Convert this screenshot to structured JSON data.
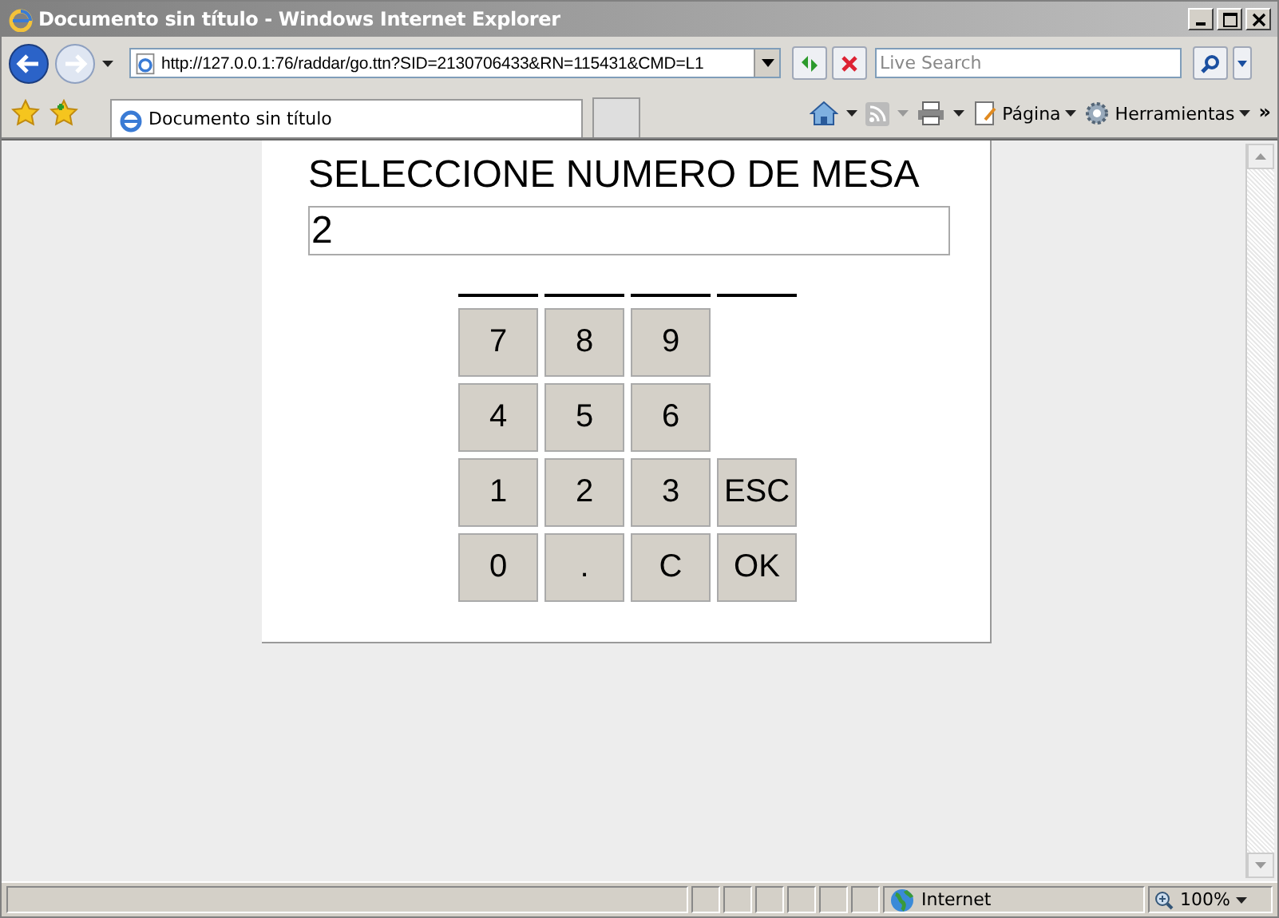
{
  "window": {
    "title": "Documento sin título - Windows Internet Explorer"
  },
  "address_bar": {
    "url": "http://127.0.0.1:76/raddar/go.ttn?SID=2130706433&RN=115431&CMD=L1"
  },
  "search": {
    "placeholder": "Live Search"
  },
  "tabs": [
    {
      "label": "Documento sin título",
      "selected": true
    }
  ],
  "command_bar": {
    "page_menu": "Página",
    "tools_menu": "Herramientas",
    "more": "»"
  },
  "page": {
    "heading": "SELECCIONE NUMERO DE MESA",
    "value": "2",
    "keypad": [
      [
        "7",
        "8",
        "9"
      ],
      [
        "4",
        "5",
        "6"
      ],
      [
        "1",
        "2",
        "3",
        "ESC"
      ],
      [
        "0",
        ".",
        "C",
        "OK"
      ]
    ]
  },
  "status_bar": {
    "zone": "Internet",
    "zoom": "100%"
  }
}
